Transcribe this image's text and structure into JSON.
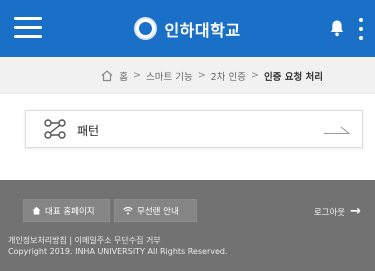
{
  "header": {
    "title": "인하대학교",
    "menu_icon": "hamburger-menu-icon",
    "seal_icon": "university-seal-icon",
    "notification_icon": "bell-icon",
    "more_icon": "kebab-more-icon",
    "background_color": "#1a6fc7"
  },
  "breadcrumb": {
    "items": [
      "홈",
      "스마트 기능",
      "2차 인증",
      "인증 요청 처리"
    ],
    "separator": ">"
  },
  "auth_method": {
    "label": "패턴",
    "icon": "pattern-icon",
    "arrow_icon": "arrow-right-icon"
  },
  "footer": {
    "home_button": "대표 홈페이지",
    "wifi_button": "무선랜 안내",
    "logout_button": "로그아웃",
    "policy": "개인정보처리방침 | 이메일주소 무단수집 거부",
    "copyright": "Copyright 2019. INHA UNIVERSITY All Rights Reserved.",
    "background_color": "#727272"
  }
}
